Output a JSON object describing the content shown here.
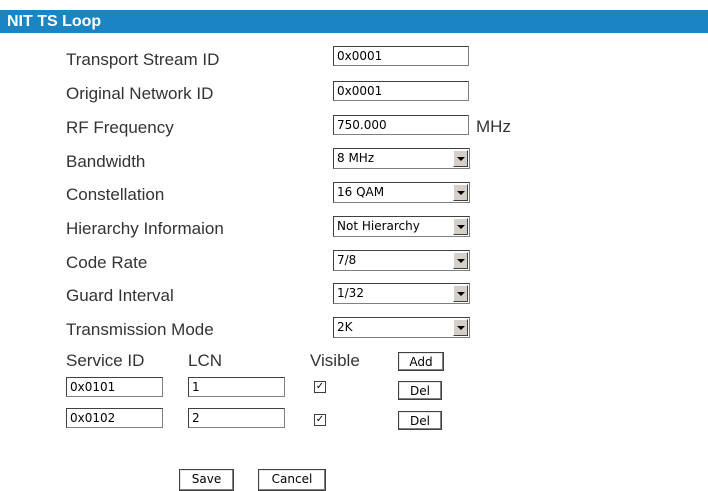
{
  "header": {
    "title": "NIT TS Loop"
  },
  "form": {
    "tsid_label": "Transport Stream ID",
    "tsid_value": "0x0001",
    "onid_label": "Original Network ID",
    "onid_value": "0x0001",
    "rf_label": "RF Frequency",
    "rf_value": "750.000",
    "rf_unit": "MHz",
    "bandwidth_label": "Bandwidth",
    "bandwidth_value": "8 MHz",
    "constellation_label": "Constellation",
    "constellation_value": "16 QAM",
    "hierarchy_label": "Hierarchy Informaion",
    "hierarchy_value": "Not Hierarchy",
    "coderate_label": "Code Rate",
    "coderate_value": "7/8",
    "guard_label": "Guard Interval",
    "guard_value": "1/32",
    "transmission_label": "Transmission Mode",
    "transmission_value": "2K"
  },
  "services": {
    "col_service_id": "Service ID",
    "col_lcn": "LCN",
    "col_visible": "Visible",
    "add_label": "Add",
    "rows": [
      {
        "service_id": "0x0101",
        "lcn": "1",
        "visible": true,
        "del_label": "Del"
      },
      {
        "service_id": "0x0102",
        "lcn": "2",
        "visible": true,
        "del_label": "Del"
      }
    ]
  },
  "actions": {
    "save_label": "Save",
    "cancel_label": "Cancel"
  }
}
